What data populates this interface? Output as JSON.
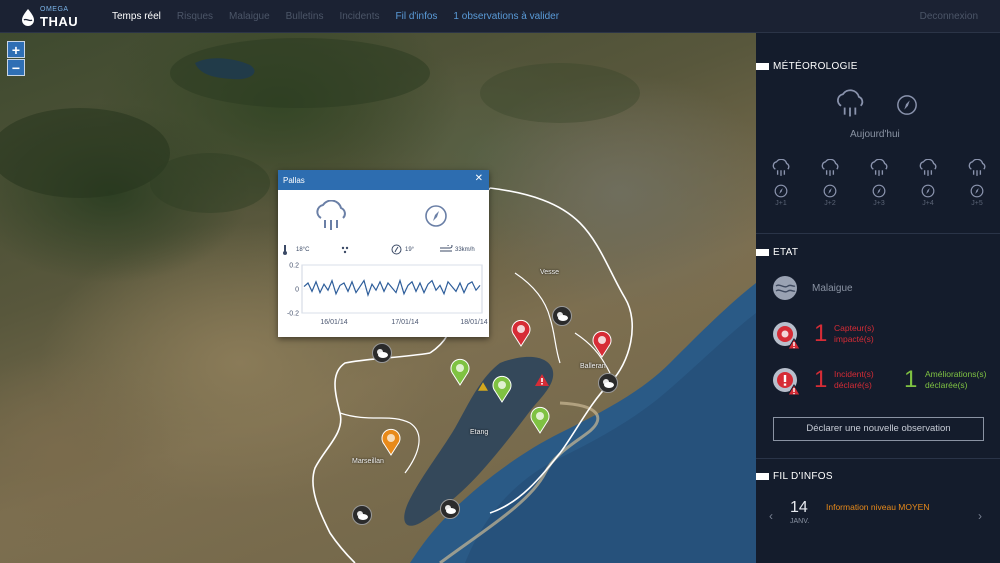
{
  "header": {
    "logo_small": "OMEGA",
    "logo_big": "THAU",
    "nav": [
      {
        "label": "Temps réel",
        "state": "active"
      },
      {
        "label": "Risques",
        "state": "dim"
      },
      {
        "label": "Malaigue",
        "state": "dim"
      },
      {
        "label": "Bulletins",
        "state": "dim"
      },
      {
        "label": "Incidents",
        "state": "dim"
      },
      {
        "label": "Fil d'infos",
        "state": "blue"
      },
      {
        "label": "1 observations à valider",
        "state": "blue"
      }
    ],
    "logout": "Deconnexion"
  },
  "map": {
    "zoom_in": "+",
    "zoom_out": "−",
    "places": {
      "vesse": "Vesse",
      "balleran": "Balleran",
      "etang": "Etang",
      "marseillan": "Marseillan"
    }
  },
  "popup": {
    "title": "Pallas",
    "close": "✕",
    "temperature": "18°C",
    "wind_dir": "19°",
    "wind_speed": "33km/h",
    "chart_data": {
      "type": "line",
      "title": "",
      "xlabel": "",
      "ylabel": "",
      "ylim": [
        -0.2,
        0.2
      ],
      "yticks": [
        "0.2",
        "0",
        "-0.2"
      ],
      "xticks": [
        "16/01/14",
        "17/01/14",
        "18/01/14"
      ],
      "x_range": [
        0,
        3
      ],
      "series": [
        {
          "values": [
            0.02,
            0.05,
            -0.02,
            0.06,
            -0.03,
            0.04,
            -0.01,
            0.07,
            -0.04,
            0.03,
            0.05,
            -0.02,
            0.06,
            -0.03,
            0.02,
            0.07,
            -0.05,
            0.04,
            -0.01,
            0.06,
            -0.02,
            0.05,
            0.01,
            -0.03,
            0.07,
            -0.04,
            0.03,
            0.06,
            -0.02,
            0.05,
            -0.03,
            0.04,
            0.07,
            -0.01,
            0.03,
            -0.04,
            0.06,
            0.02,
            -0.02,
            0.05,
            -0.03,
            0.04,
            0.06,
            -0.01,
            0.03
          ]
        }
      ]
    }
  },
  "sidebar": {
    "meteo_title": "MÉTÉOROLOGIE",
    "today_label": "Aujourd'hui",
    "days": [
      "J+1",
      "J+2",
      "J+3",
      "J+4",
      "J+5"
    ],
    "etat_title": "ETAT",
    "malaigue_label": "Malaigue",
    "capteurs_count": "1",
    "capteurs_label_1": "Capteur(s)",
    "capteurs_label_2": "impacté(s)",
    "incidents_count": "1",
    "incidents_label_1": "Incident(s)",
    "incidents_label_2": "déclaré(s)",
    "ameliorations_count": "1",
    "ameliorations_label_1": "Améliorations(s)",
    "ameliorations_label_2": "déclarée(s)",
    "declare_button": "Déclarer une nouvelle observation",
    "fil_title": "FIL D'INFOS",
    "info_day": "14",
    "info_month": "JANV.",
    "info_text": "Information niveau MOYEN",
    "prev": "‹",
    "next": "›"
  },
  "colors": {
    "red": "#d62c36",
    "green": "#7fc242",
    "orange": "#e88a1a",
    "blue": "#2d6db0"
  }
}
